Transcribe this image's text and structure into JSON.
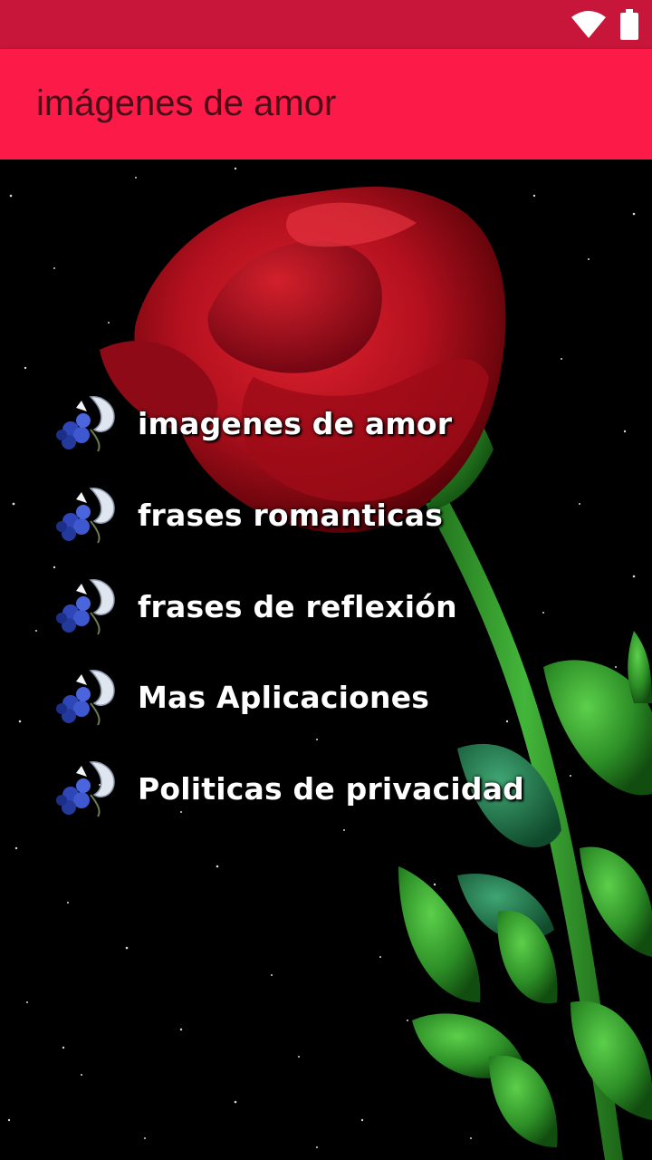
{
  "status_bar": {
    "icons": [
      "wifi-icon",
      "battery-icon"
    ],
    "color": "#c8163a"
  },
  "app_bar": {
    "title": "imágenes de amor",
    "color": "#fb1a48",
    "title_color": "#4a0d18"
  },
  "menu": {
    "items": [
      {
        "label": "imagenes de amor",
        "icon": "blue-flowers-icon"
      },
      {
        "label": "frases romanticas",
        "icon": "blue-flowers-icon"
      },
      {
        "label": "frases de reflexión",
        "icon": "blue-flowers-icon"
      },
      {
        "label": "Mas Aplicaciones",
        "icon": "blue-flowers-icon"
      },
      {
        "label": "Politicas de privacidad",
        "icon": "blue-flowers-icon"
      }
    ]
  },
  "background": {
    "image": "red-rose-on-starry-night",
    "colors": {
      "sky": "#000000",
      "rose": "#b3101e",
      "leaf": "#2f9a2a"
    }
  }
}
